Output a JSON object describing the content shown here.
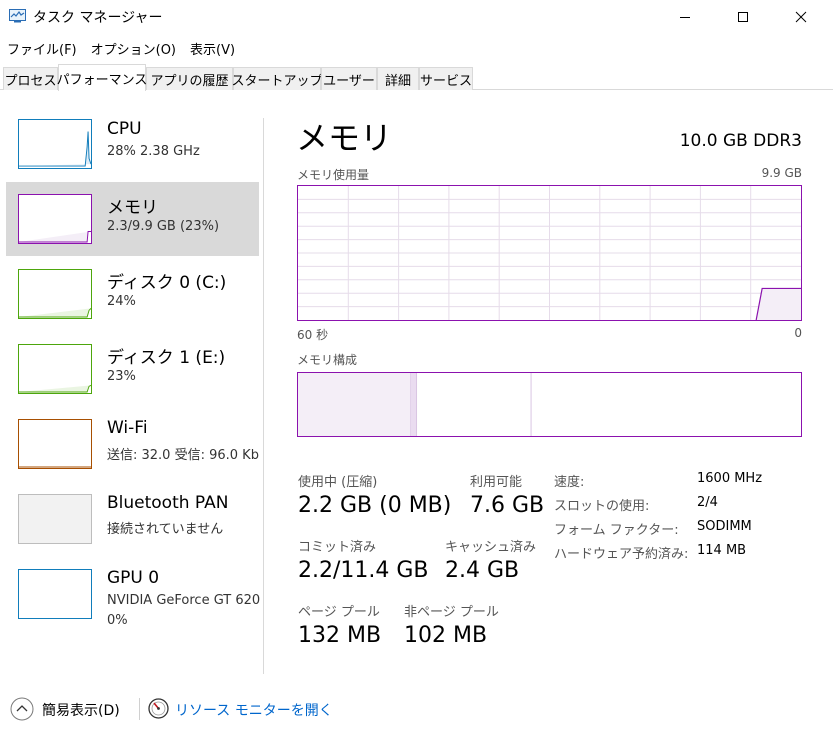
{
  "window": {
    "title": "タスク マネージャー"
  },
  "menu": [
    "ファイル(F)",
    "オプション(O)",
    "表示(V)"
  ],
  "tabs": [
    "プロセス",
    "パフォーマンス",
    "アプリの履歴",
    "スタートアップ",
    "ユーザー",
    "詳細",
    "サービス"
  ],
  "active_tab": "パフォーマンス",
  "sidebar": {
    "items": [
      {
        "title": "CPU",
        "subtitle": "28% 2.38 GHz",
        "color": "#117dbb"
      },
      {
        "title": "メモリ",
        "subtitle": "2.3/9.9 GB (23%)",
        "color": "#8b12ae",
        "selected": true
      },
      {
        "title": "ディスク 0 (C:)",
        "subtitle": "24%",
        "color": "#4da60c"
      },
      {
        "title": "ディスク 1 (E:)",
        "subtitle": "23%",
        "color": "#4da60c"
      },
      {
        "title": "Wi-Fi",
        "subtitle": "送信: 32.0  受信: 96.0 Kb",
        "color": "#a74f01"
      },
      {
        "title": "Bluetooth PAN",
        "subtitle": "接続されていません",
        "color": "#bdbdbd"
      },
      {
        "title": "GPU 0",
        "subtitle": "NVIDIA GeForce GT 620",
        "subtitle2": "0%",
        "color": "#117dbb"
      }
    ]
  },
  "main": {
    "title": "メモリ",
    "spec": "10.0 GB DDR3",
    "usage_label": "メモリ使用量",
    "usage_max": "9.9 GB",
    "time_left": "60 秒",
    "time_right": "0",
    "composition_label": "メモリ構成",
    "in_use_fraction": 0.23,
    "stats": {
      "in_use_label": "使用中 (圧縮)",
      "in_use_value": "2.2 GB (0 MB)",
      "available_label": "利用可能",
      "available_value": "7.6 GB",
      "committed_label": "コミット済み",
      "committed_value": "2.2/11.4 GB",
      "cached_label": "キャッシュ済み",
      "cached_value": "2.4 GB",
      "paged_label": "ページ プール",
      "paged_value": "132 MB",
      "nonpaged_label": "非ページ プール",
      "nonpaged_value": "102 MB"
    },
    "specs": {
      "speed_label": "速度:",
      "speed_value": "1600 MHz",
      "slots_label": "スロットの使用:",
      "slots_value": "2/4",
      "form_label": "フォーム ファクター:",
      "form_value": "SODIMM",
      "reserved_label": "ハードウェア予約済み:",
      "reserved_value": "114 MB"
    }
  },
  "bottom": {
    "fewer_details": "簡易表示(D)",
    "resource_monitor": "リソース モニターを開く"
  },
  "icons": {
    "app": "task-manager-icon",
    "minimize": "minimize-icon",
    "maximize": "maximize-icon",
    "close": "close-icon",
    "fewer": "chevron-up-icon",
    "resmon": "resource-monitor-icon"
  },
  "colors": {
    "memory": "#8b12ae",
    "link": "#0066cc",
    "selected_bg": "#d9d9d9"
  }
}
